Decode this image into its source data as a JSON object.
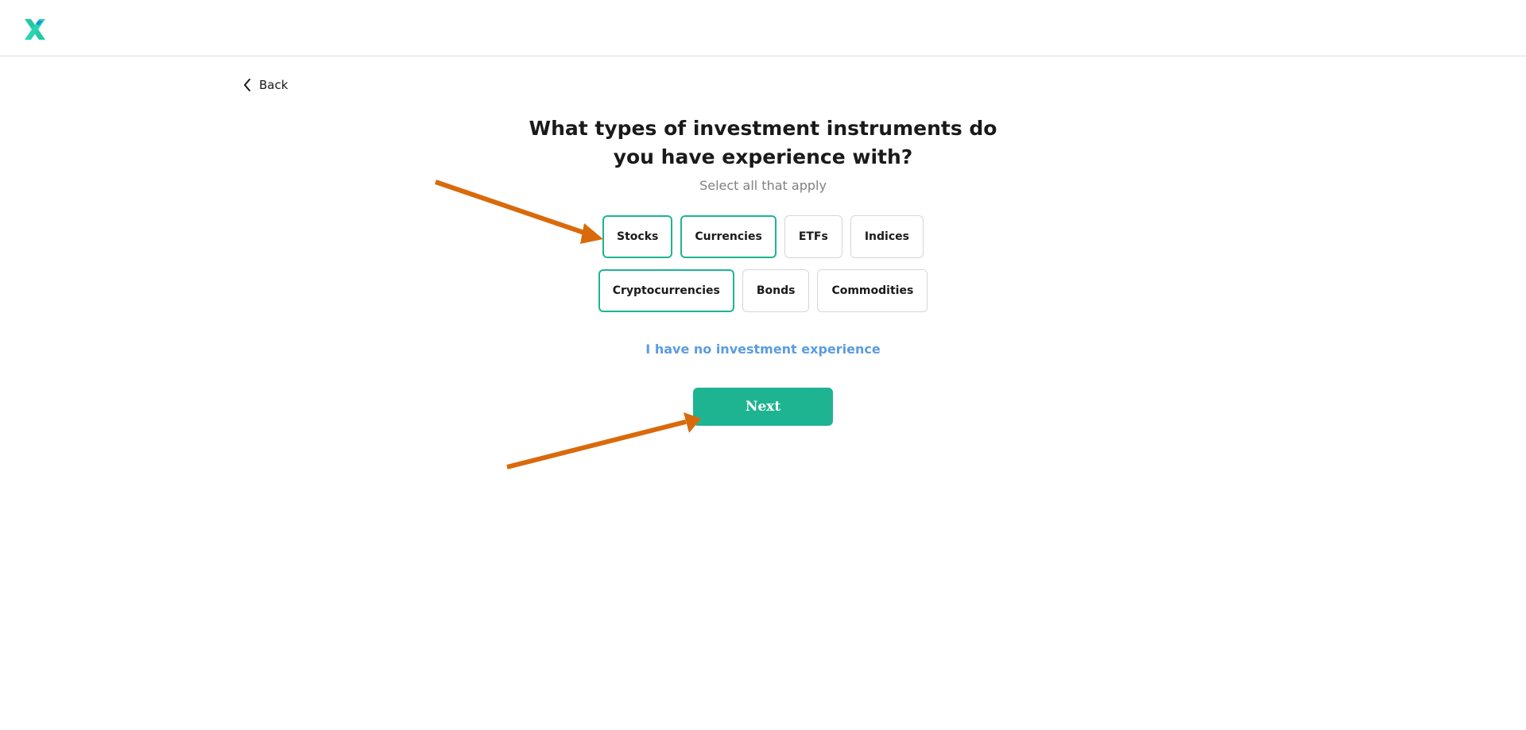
{
  "header": {
    "logo_icon": "x-logo-icon",
    "colors": {
      "logo_primary": "#23c9a6",
      "logo_secondary": "#1e90e0"
    }
  },
  "nav": {
    "back_label": "Back",
    "back_icon": "chevron-left-icon"
  },
  "question": {
    "title": "What types of investment instruments do you have experience with?",
    "subtitle": "Select all that apply"
  },
  "options": [
    {
      "label": "Stocks",
      "selected": true
    },
    {
      "label": "Currencies",
      "selected": true
    },
    {
      "label": "ETFs",
      "selected": false
    },
    {
      "label": "Indices",
      "selected": false
    },
    {
      "label": "Cryptocurrencies",
      "selected": true
    },
    {
      "label": "Bonds",
      "selected": false
    },
    {
      "label": "Commodities",
      "selected": false
    }
  ],
  "no_experience_label": "I have no investment experience",
  "next_label": "Next",
  "annotations": {
    "arrow_color": "#d96a0b",
    "arrow_targets": [
      "Stocks",
      "Next"
    ]
  },
  "theme": {
    "accent": "#1fb491",
    "link": "#5a9ce0",
    "border": "#d6d6d6",
    "text": "#1a1a1a",
    "muted": "#808080"
  }
}
